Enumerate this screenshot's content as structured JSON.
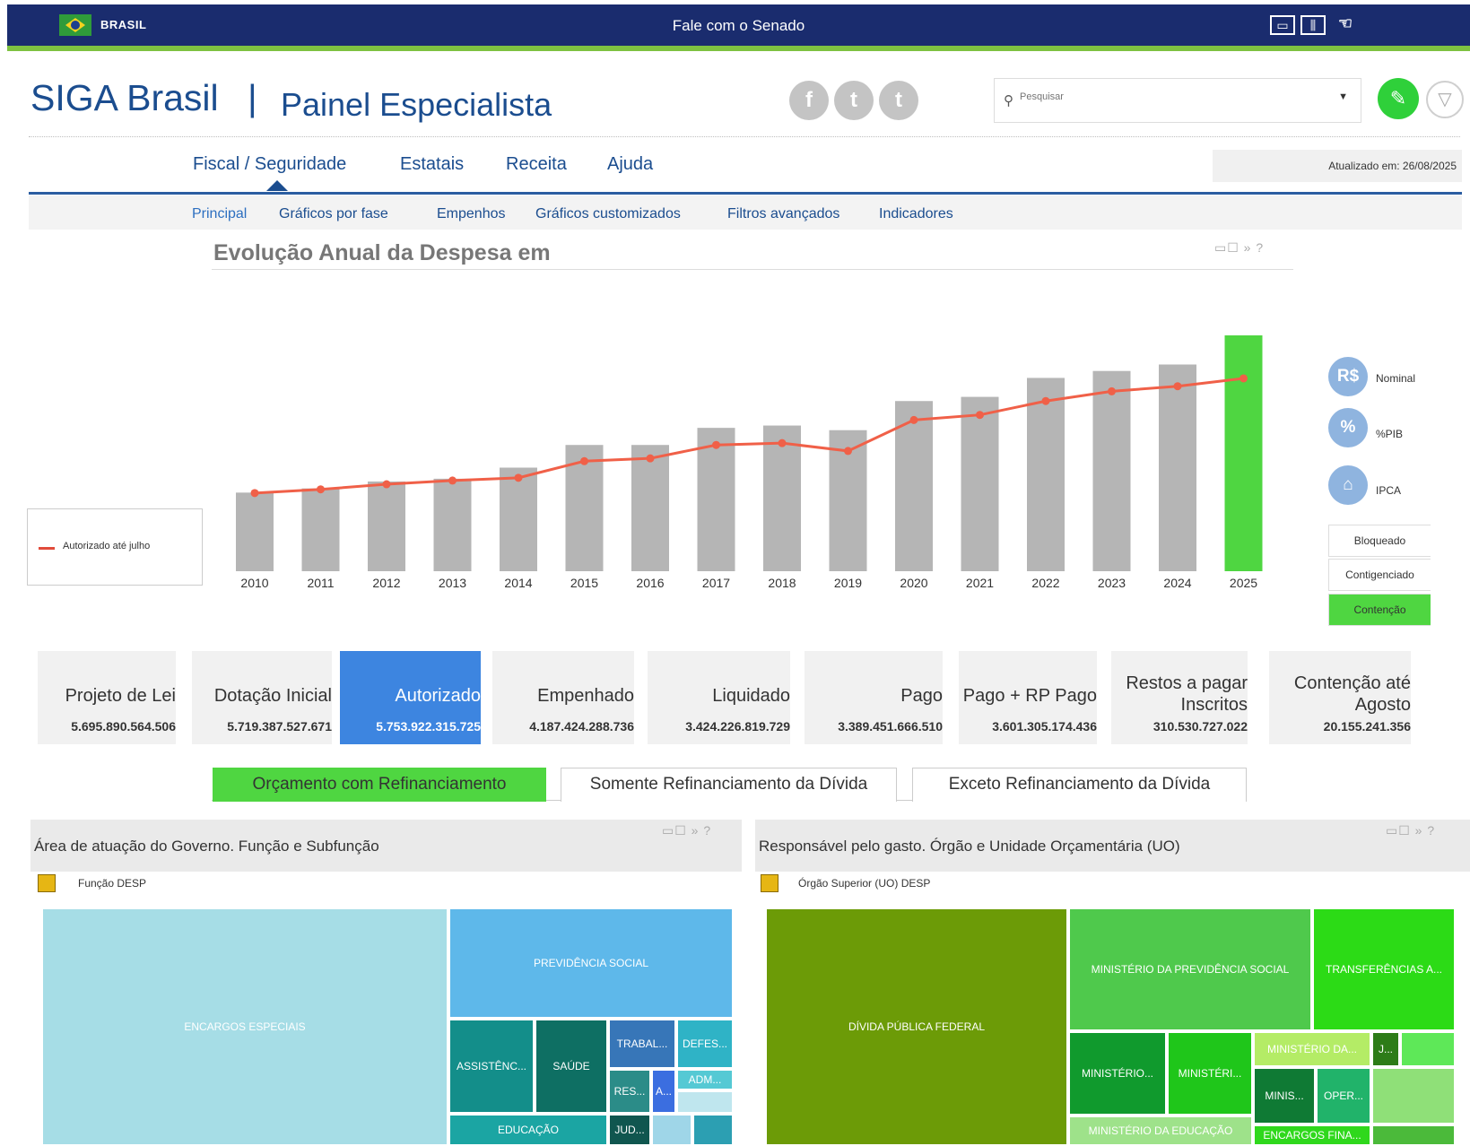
{
  "gov_bar": {
    "brand": "BRASIL",
    "center_link": "Fale com o Senado",
    "colors": {
      "background": "#1a2c6e",
      "stripe": "#7ec241"
    }
  },
  "header": {
    "app_name": "SIGA Brasil",
    "separator": "|",
    "subtitle": "Painel Especialista",
    "social": [
      "f",
      "t",
      "t"
    ],
    "search_placeholder": "Pesquisar",
    "accent_color": "#2fd03a"
  },
  "main_nav": {
    "items": [
      "Fiscal / Seguridade",
      "Estatais",
      "Receita",
      "Ajuda"
    ],
    "updated": "Atualizado em: 26/08/2025"
  },
  "sub_nav": {
    "items": [
      "Principal",
      "Gráficos por fase",
      "Empenhos",
      "Gráficos customizados",
      "Filtros avançados",
      "Indicadores"
    ]
  },
  "chart": {
    "title": "Evolução Anual da Despesa em",
    "tools": "▭☐ » ?",
    "legend": "Autorizado até julho",
    "modes": [
      {
        "icon": "R$",
        "label": "Nominal"
      },
      {
        "icon": "%",
        "label": "%PIB"
      },
      {
        "icon": "⌂",
        "label": "IPCA"
      }
    ],
    "options": [
      "Bloqueado",
      "Contigenciado",
      "Contenção"
    ]
  },
  "chart_data": {
    "type": "bar",
    "categories": [
      "2010",
      "2011",
      "2012",
      "2013",
      "2014",
      "2015",
      "2016",
      "2017",
      "2018",
      "2019",
      "2020",
      "2021",
      "2022",
      "2023",
      "2024",
      "2025"
    ],
    "series": [
      {
        "kind": "bar",
        "values": [
          1.7,
          1.79,
          1.94,
          2.0,
          2.24,
          2.73,
          2.73,
          3.1,
          3.15,
          3.05,
          3.68,
          3.77,
          4.18,
          4.33,
          4.47,
          5.1
        ]
      },
      {
        "kind": "line",
        "name": "Autorizado até julho",
        "values": [
          1.69,
          1.77,
          1.88,
          1.96,
          2.02,
          2.38,
          2.44,
          2.73,
          2.77,
          2.6,
          3.27,
          3.38,
          3.68,
          3.89,
          4.0,
          4.17
        ]
      }
    ],
    "highlight_category": "2025",
    "ylim": [
      0,
      5.1
    ],
    "grid": false,
    "colors": {
      "bar": "#b5b5b5",
      "highlight_bar": "#4fd641",
      "line": "#f06048"
    }
  },
  "cards": [
    {
      "label": "Projeto de Lei",
      "value": "5.695.890.564.506"
    },
    {
      "label": "Dotação Inicial",
      "value": "5.719.387.527.671"
    },
    {
      "label": "Autorizado",
      "value": "5.753.922.315.725"
    },
    {
      "label": "Empenhado",
      "value": "4.187.424.288.736"
    },
    {
      "label": "Liquidado",
      "value": "3.424.226.819.729"
    },
    {
      "label": "Pago",
      "value": "3.389.451.666.510"
    },
    {
      "label": "Pago + RP Pago",
      "value": "3.601.305.174.436"
    },
    {
      "label": "Restos a pagar Inscritos",
      "value": "310.530.727.022"
    },
    {
      "label": "Contenção até Agosto",
      "value": "20.155.241.356"
    }
  ],
  "budget_tabs": [
    "Orçamento com Refinanciamento",
    "Somente Refinanciamento da Dívida",
    "Exceto Refinanciamento da Dívida"
  ],
  "panel_left": {
    "title": "Área de atuação do Governo. Função e Subfunção",
    "subtitle": "Função DESP",
    "tiles": [
      "ENCARGOS ESPECIAIS",
      "PREVIDÊNCIA SOCIAL",
      "ASSISTÊNC...",
      "SAÚDE",
      "TRABAL...",
      "DEFES...",
      "RES...",
      "A...",
      "ADM...",
      "EDUCAÇÃO",
      "JUD..."
    ]
  },
  "panel_right": {
    "title": "Responsável pelo gasto. Órgão e Unidade Orçamentária (UO)",
    "subtitle": "Órgão Superior (UO) DESP",
    "tiles": [
      "DÍVIDA PÚBLICA FEDERAL",
      "MINISTÉRIO DA PREVIDÊNCIA SOCIAL",
      "TRANSFERÊNCIAS A...",
      "MINISTÉRIO...",
      "MINISTÉRI...",
      "MINISTÉRIO DA...",
      "J...",
      "MINIS...",
      "OPER...",
      "MINISTÉRIO DA EDUCAÇÃO",
      "ENCARGOS FINA..."
    ]
  }
}
